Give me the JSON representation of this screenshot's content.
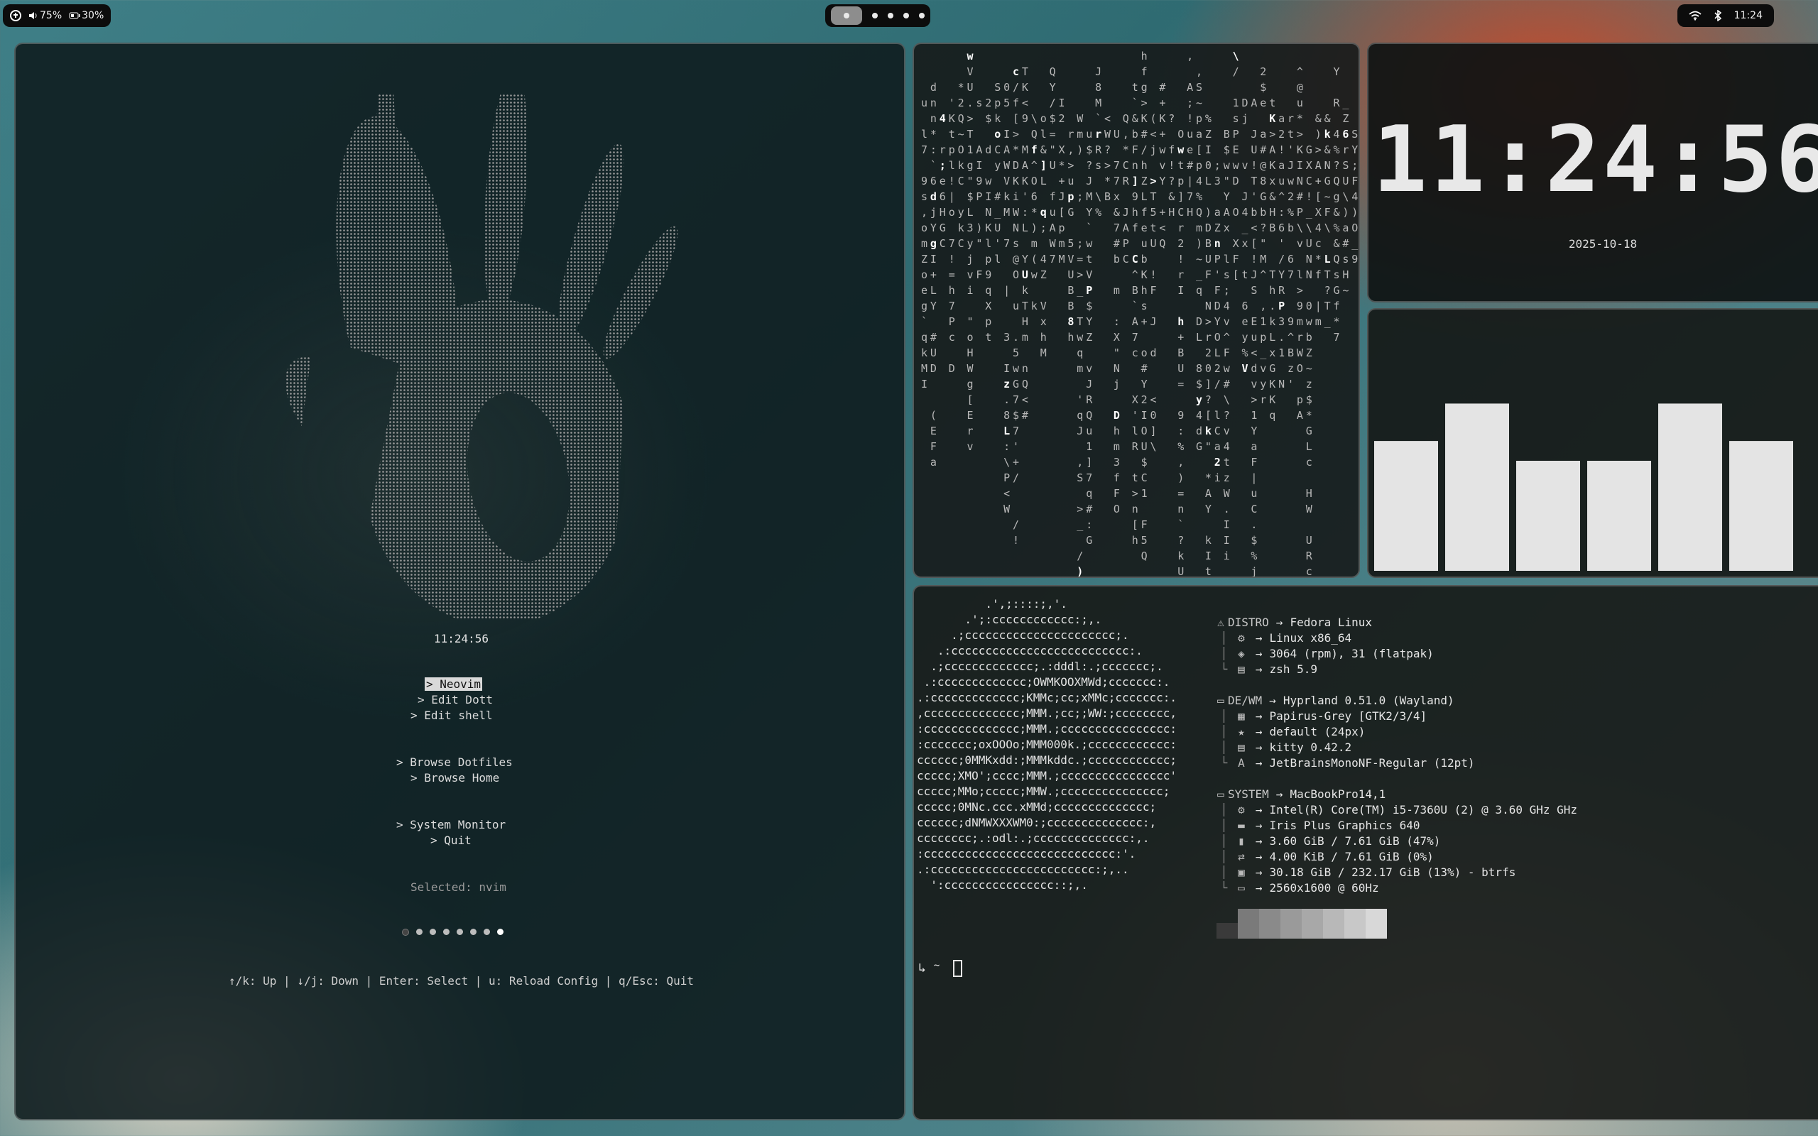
{
  "topbar": {
    "left": {
      "distro_icon": "fedora-icon",
      "volume": "75%",
      "battery": "30%"
    },
    "workspaces": [
      {
        "active": true
      },
      {
        "active": false
      },
      {
        "active": false
      },
      {
        "active": false
      },
      {
        "active": false
      }
    ],
    "right": {
      "clock": "11:24"
    }
  },
  "launcher": {
    "time": "11:24:56",
    "menu": [
      {
        "label": "> Neovim",
        "selected": true
      },
      {
        "label": "> Edit Dott",
        "selected": false
      },
      {
        "label": "> Edit shell",
        "selected": false
      },
      {
        "label": "> Browse Dotfiles",
        "selected": false
      },
      {
        "label": "> Browse Home",
        "selected": false
      },
      {
        "label": "> System Monitor",
        "selected": false
      },
      {
        "label": "> Quit",
        "selected": false
      }
    ],
    "selected_text": "Selected: nvim",
    "page_dots": 8,
    "current_dot": 1,
    "help": "↑/k: Up | ↓/j: Down | Enter: Select | u: Reload Config | q/Esc: Quit"
  },
  "clock": {
    "time": "11:24:56",
    "date": "2025-10-18"
  },
  "visualizer": {
    "bar_levels": [
      0.59,
      0.76,
      0.5,
      0.5,
      0.76,
      0.59
    ]
  },
  "fetch": {
    "logo_lines": [
      "          .',;::::;,'.",
      "       .';:cccccccccccc:;,.",
      "     .;cccccccccccccccccccccc;.",
      "   .:cccccccccccccccccccccccccc:.",
      "  .;ccccccccccccc;.:dddl:.;ccccccc;.",
      " .:ccccccccccccc;OWMKOOXMWd;ccccccc:.",
      ".:ccccccccccccc;KMMc;cc;xMMc;ccccccc:.",
      ",cccccccccccccc;MMM.;cc;;WW:;cccccccc,",
      ":cccccccccccccc;MMM.;cccccccccccccccc:",
      ":ccccccc;oxOOOo;MMM000k.;cccccccccccc:",
      "cccccc;0MMKxdd:;MMMkddc.;cccccccccccc;",
      "ccccc;XMO';cccc;MMM.;cccccccccccccccc'",
      "ccccc;MMo;ccccc;MMW.;ccccccccccccccc;",
      "ccccc;0MNc.ccc.xMMd;cccccccccccccc;",
      "cccccc;dNMWXXXWM0:;cccccccccccccc:,",
      "cccccccc;.:odl:.;cccccccccccccc:,.",
      ":cccccccccccccccccccccccccccc:'.",
      ".:cccccccccccccccccccccccc:;,..",
      "  ':cccccccccccccccc::;,."
    ],
    "sections": [
      {
        "label": "DISTRO",
        "value": "Fedora Linux",
        "icon": "fedora-icon",
        "rows": [
          {
            "icon": "gear-icon",
            "value": "Linux x86_64"
          },
          {
            "icon": "package-icon",
            "value": "3064 (rpm), 31 (flatpak)"
          },
          {
            "icon": "terminal-icon",
            "value": "zsh 5.9"
          }
        ]
      },
      {
        "label": "DE/WM",
        "value": "Hyprland 0.51.0 (Wayland)",
        "icon": "window-icon",
        "rows": [
          {
            "icon": "grid-icon",
            "value": "Papirus-Grey [GTK2/3/4]"
          },
          {
            "icon": "star-icon",
            "value": "default (24px)"
          },
          {
            "icon": "terminal-icon",
            "value": "kitty 0.42.2"
          },
          {
            "icon": "font-icon",
            "value": "JetBrainsMonoNF-Regular (12pt)"
          }
        ]
      },
      {
        "label": "SYSTEM",
        "value": "MacBookPro14,1",
        "icon": "laptop-icon",
        "rows": [
          {
            "icon": "cpu-icon",
            "value": "Intel(R) Core(TM) i5-7360U (2) @ 3.60 GHz GHz"
          },
          {
            "icon": "gpu-icon",
            "value": "Iris Plus Graphics 640"
          },
          {
            "icon": "memory-icon",
            "value": "3.60 GiB / 7.61 GiB (47%)"
          },
          {
            "icon": "swap-icon",
            "value": "4.00 KiB / 7.61 GiB (0%)"
          },
          {
            "icon": "disk-icon",
            "value": "30.18 GiB / 232.17 GiB (13%) - btrfs"
          },
          {
            "icon": "monitor-icon",
            "value": "2560x1600 @ 60Hz"
          }
        ]
      }
    ],
    "palette": [
      "#3a3a3a",
      "#7a7a7a",
      "#8a8a8a",
      "#9a9a9a",
      "#a8a8a8",
      "#b8b8b8",
      "#c8c8c8",
      "#d8d8d8"
    ],
    "prompt_dir": "~"
  }
}
